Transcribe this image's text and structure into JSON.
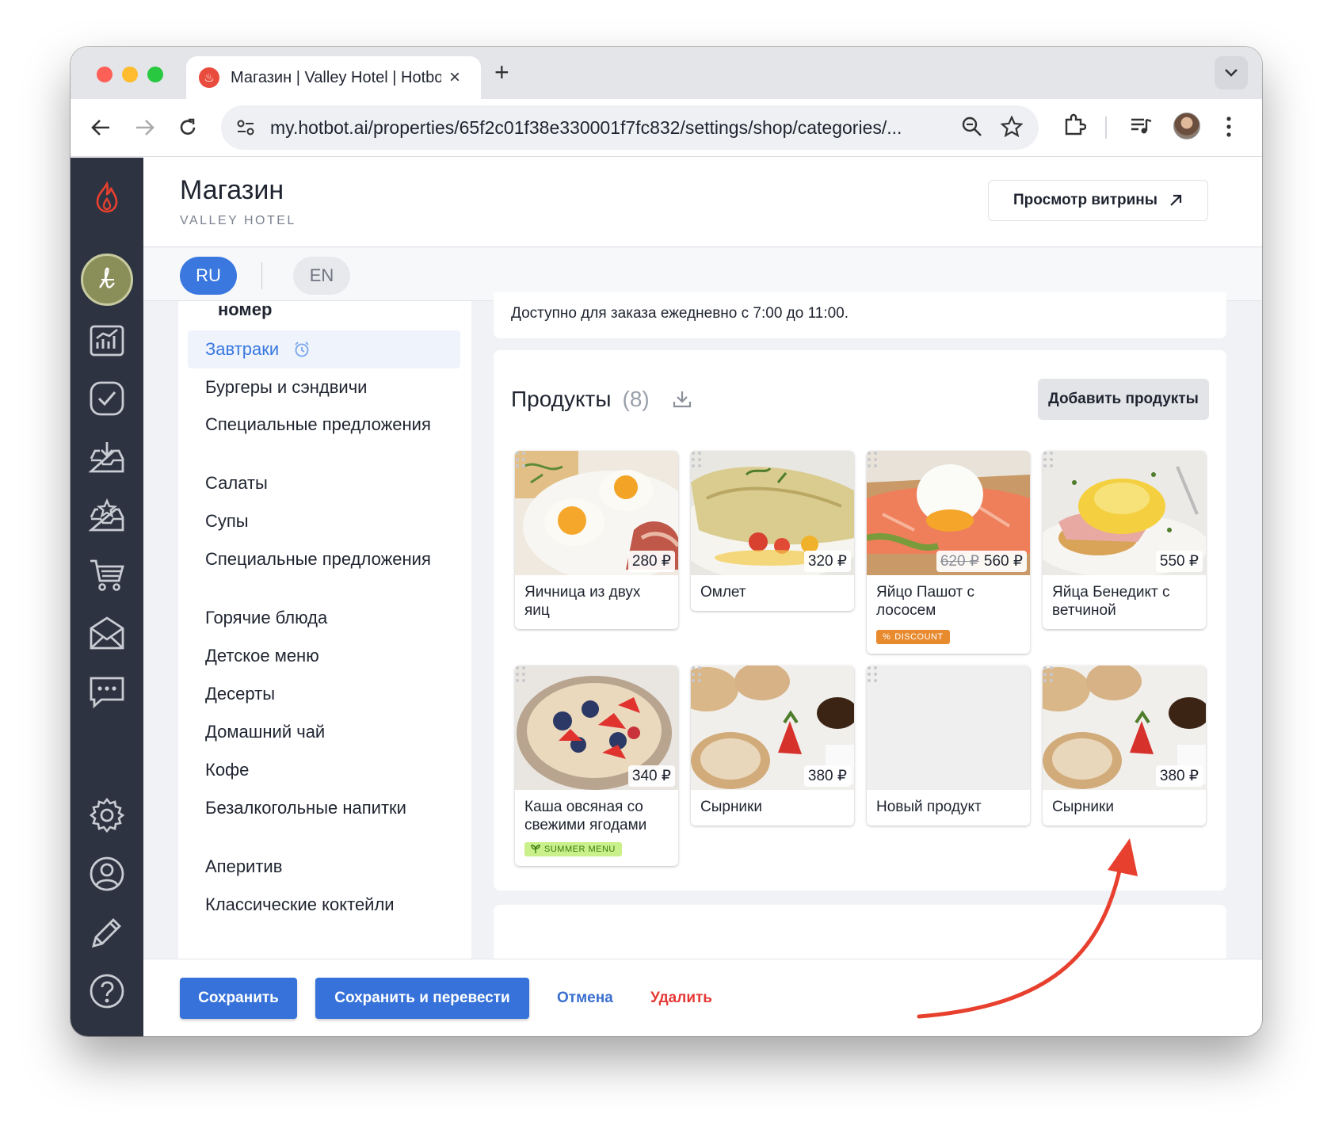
{
  "browser": {
    "tab_title": "Магазин | Valley Hotel | Hotbot",
    "url": "my.hotbot.ai/properties/65f2c01f38e330001f7fc832/settings/shop/categories/..."
  },
  "header": {
    "title": "Магазин",
    "subtitle": "VALLEY HOTEL",
    "preview_label": "Просмотр витрины"
  },
  "languages": {
    "active": "RU",
    "other": "EN"
  },
  "categories": {
    "cut_label": "номер",
    "active": "Завтраки",
    "items": [
      "Бургеры и сэндвичи",
      "Специальные предложения",
      "Салаты",
      "Супы",
      "Специальные предложения",
      "Горячие блюда",
      "Детское меню",
      "Десерты",
      "Домашний чай",
      "Кофе",
      "Безалкогольные напитки",
      "Аперитив",
      "Классические коктейли"
    ]
  },
  "description": "Доступно для заказа ежедневно с 7:00 до 11:00.",
  "products": {
    "title": "Продукты",
    "count": "(8)",
    "add_label": "Добавить продукты",
    "items": [
      {
        "name": "Яичница из двух яиц",
        "price": "280 ₽",
        "image": "fried-eggs"
      },
      {
        "name": "Омлет",
        "price": "320 ₽",
        "image": "omelette"
      },
      {
        "name": "Яйцо Пашот с лососем",
        "old_price": "620 ₽",
        "price": "560 ₽",
        "badge": "DISCOUNT",
        "image": "poached-egg-salmon"
      },
      {
        "name": "Яйца Бенедикт с ветчиной",
        "price": "550 ₽",
        "image": "eggs-benedict"
      },
      {
        "name": "Каша овсяная со свежими ягодами",
        "price": "340 ₽",
        "badge": "SUMMER MENU",
        "image": "oatmeal-berries"
      },
      {
        "name": "Сырники",
        "price": "380 ₽",
        "image": "syrniki"
      },
      {
        "name": "Новый продукт",
        "image": "empty"
      },
      {
        "name": "Сырники",
        "price": "380 ₽",
        "image": "syrniki"
      }
    ]
  },
  "footer": {
    "save": "Сохранить",
    "save_translate": "Сохранить и перевести",
    "cancel": "Отмена",
    "delete": "Удалить"
  },
  "colors": {
    "accent": "#3a78e0",
    "danger": "#e53935",
    "rail": "#2d3340",
    "annotation_arrow": "#e8402e"
  }
}
